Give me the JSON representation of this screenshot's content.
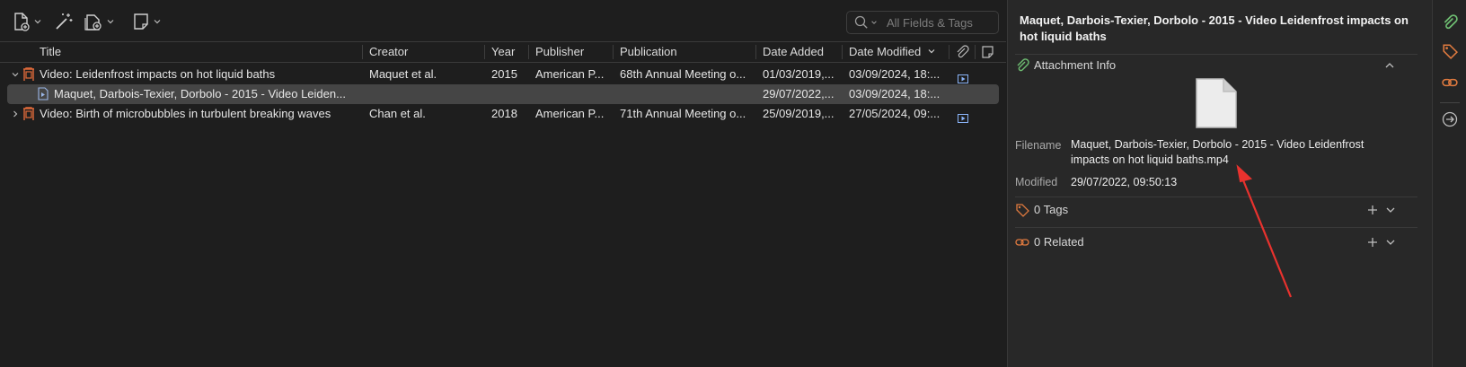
{
  "toolbar": {
    "buttons": [
      {
        "name": "new-item-button",
        "icon": "new-document-icon"
      },
      {
        "name": "add-by-identifier-button",
        "icon": "magic-wand-icon"
      },
      {
        "name": "add-attachment-button",
        "icon": "attachment-add-icon"
      },
      {
        "name": "new-note-button",
        "icon": "note-icon"
      }
    ],
    "search": {
      "placeholder": "All Fields & Tags",
      "value": ""
    }
  },
  "columns": [
    "Title",
    "Creator",
    "Year",
    "Publisher",
    "Publication",
    "Date Added",
    "Date Modified"
  ],
  "rows": [
    {
      "expanded": true,
      "title": "Video: Leidenfrost impacts on hot liquid baths",
      "creator": "Maquet et al.",
      "year": "2015",
      "publisher": "American P...",
      "publication": "68th Annual Meeting o...",
      "date_added": "01/03/2019,...",
      "date_modified": "03/09/2024, 18:..."
    },
    {
      "child": true,
      "selected": true,
      "title": "Maquet, Darbois-Texier, Dorbolo - 2015 - Video Leiden...",
      "date_added": "29/07/2022,...",
      "date_modified": "03/09/2024, 18:..."
    },
    {
      "expanded": false,
      "title": "Video: Birth of microbubbles in turbulent breaking waves",
      "creator": "Chan et al.",
      "year": "2018",
      "publisher": "American P...",
      "publication": "71th Annual Meeting o...",
      "date_added": "25/09/2019,...",
      "date_modified": "27/05/2024, 09:..."
    }
  ],
  "detail": {
    "title": "Maquet, Darbois-Texier, Dorbolo - 2015 - Video Leidenfrost impacts on hot liquid baths",
    "attachment_section": "Attachment Info",
    "filename_label": "Filename",
    "filename_value": "Maquet, Darbois-Texier, Dorbolo - 2015 - Video Leidenfrost impacts on hot liquid baths.mp4",
    "modified_label": "Modified",
    "modified_value": "29/07/2022, 09:50:13",
    "tags_section": "0 Tags",
    "related_section": "0 Related"
  },
  "colors": {
    "accent_green": "#6fbf73",
    "tag_orange": "#e07a3f",
    "arrow_red": "#e8322e",
    "selection": "#454545"
  }
}
